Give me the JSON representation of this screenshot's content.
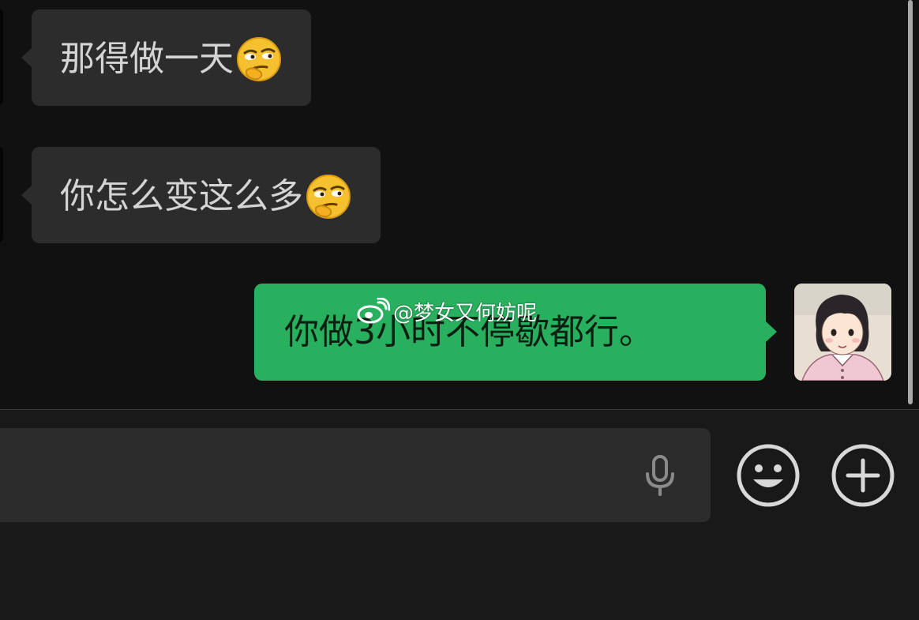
{
  "messages": [
    {
      "side": "incoming",
      "text": "那得做一天",
      "emoji": "thinking-smirk-emoji"
    },
    {
      "side": "incoming",
      "text": "你怎么变这么多",
      "emoji": "thinking-smirk-emoji"
    },
    {
      "side": "outgoing",
      "text": "你做3小时不停歇都行。"
    }
  ],
  "watermark": {
    "text": "@梦女又何妨呢",
    "icon": "weibo-icon"
  },
  "input_bar": {
    "mic_icon": "microphone-icon",
    "emoji_button_icon": "smiley-face-icon",
    "plus_button_icon": "plus-circle-icon"
  },
  "colors": {
    "background": "#191919",
    "chat_background": "#111111",
    "incoming_bubble": "#2c2c2c",
    "outgoing_bubble": "#29b05f",
    "incoming_text": "#d4d4d4",
    "outgoing_text": "#0a1f12"
  }
}
